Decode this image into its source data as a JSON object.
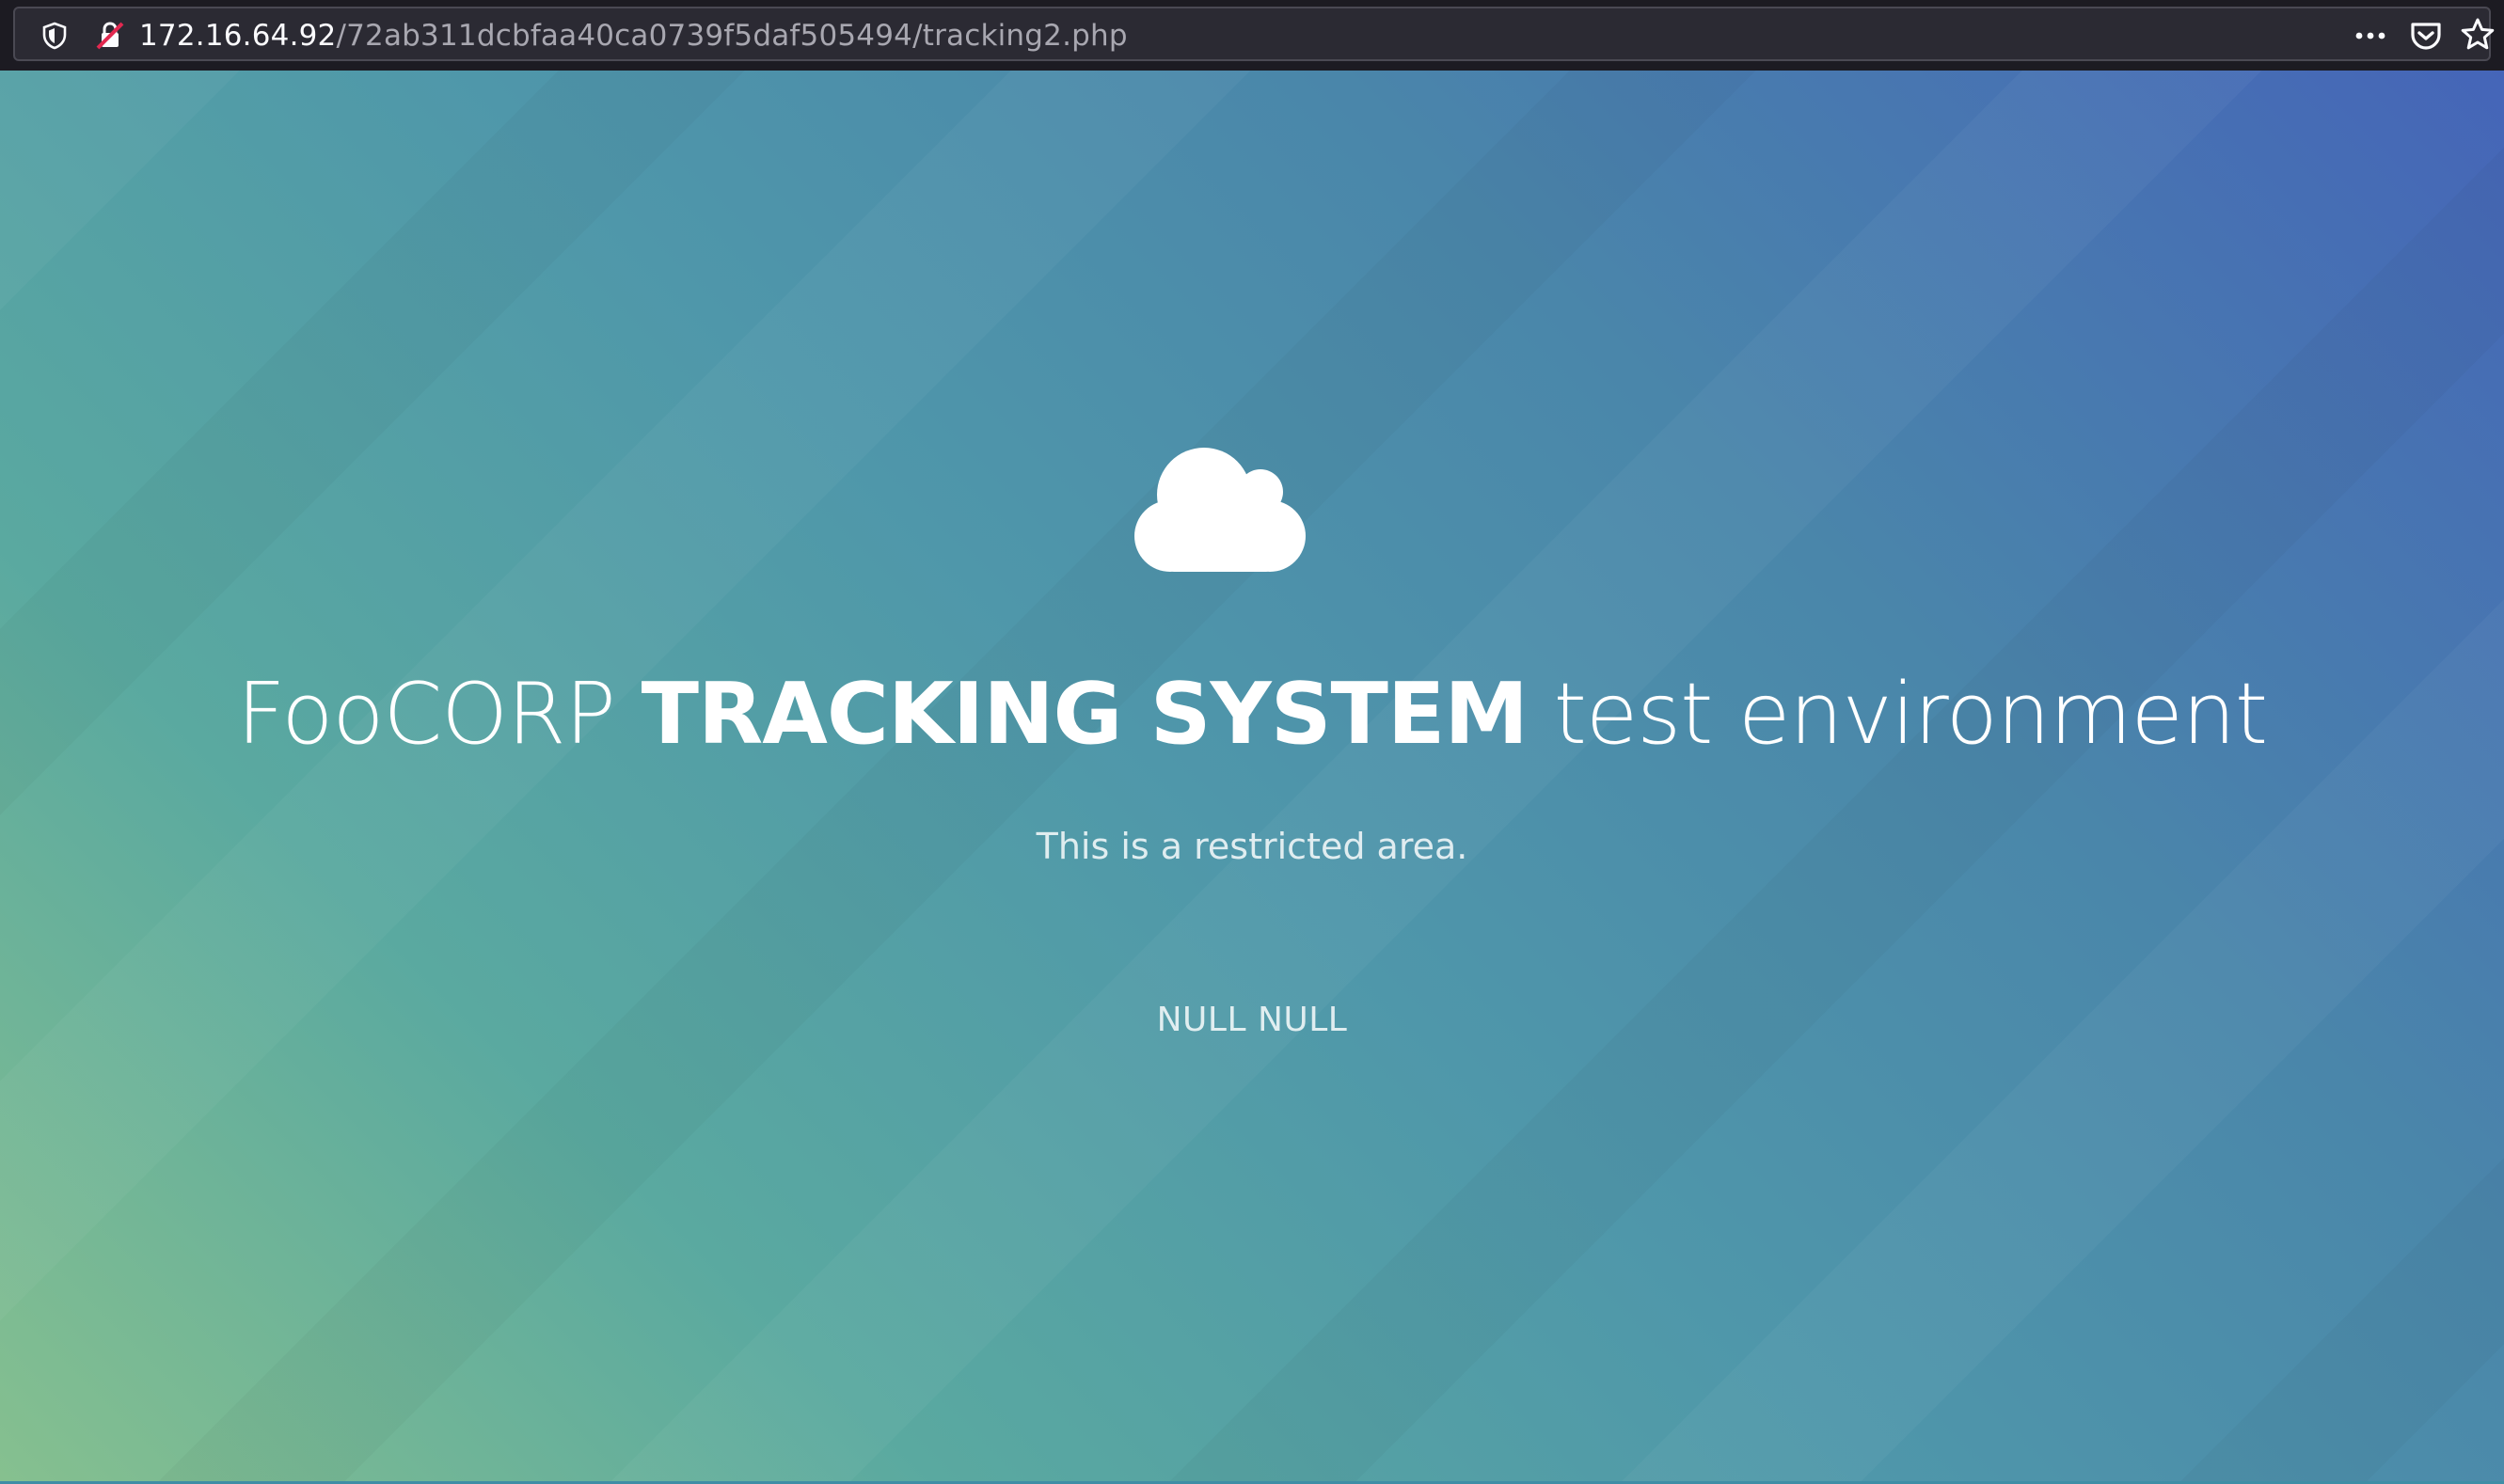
{
  "browser": {
    "url_host": "172.16.64.92",
    "url_path": "/72ab311dcbfaa40ca0739f5daf505494/tracking2.php",
    "icons": {
      "tracking_protection": "shield-icon",
      "connection_status": "insecure-connection-icon",
      "page_actions": "more-icon",
      "pocket": "pocket-icon",
      "bookmark": "star-icon"
    }
  },
  "page": {
    "logo_icon": "cloud-icon",
    "headline": {
      "prefix": "FooCORP ",
      "strong": "TRACKING SYSTEM",
      "suffix": " test environment"
    },
    "subtitle": "This is a restricted area.",
    "status": "NULL NULL",
    "colors": {
      "gradient_start": "#86c08f",
      "gradient_mid": "#4f97aa",
      "gradient_end": "#4565b8",
      "text": "#ffffff"
    }
  }
}
